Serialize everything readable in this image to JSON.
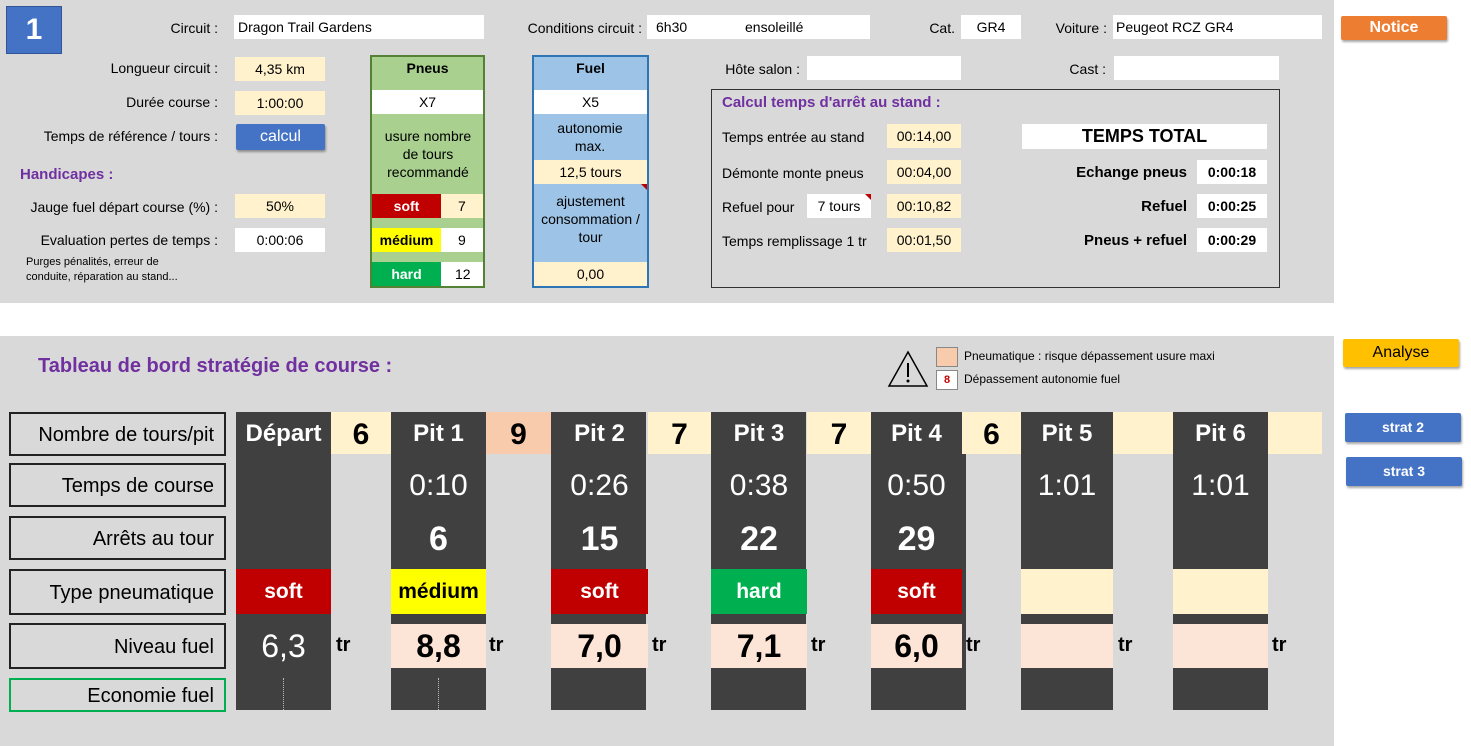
{
  "top": {
    "badge": "1",
    "circuit_label": "Circuit :",
    "circuit_value": "Dragon Trail Gardens",
    "conditions_label": "Conditions circuit :",
    "conditions_time": "6h30",
    "conditions_weather": "ensoleillé",
    "cat_label": "Cat.",
    "cat_value": "GR4",
    "car_label": "Voiture :",
    "car_value": "Peugeot RCZ GR4",
    "notice_button": "Notice",
    "length_label": "Longueur circuit :",
    "length_value": "4,35 km",
    "duration_label": "Durée course :",
    "duration_value": "1:00:00",
    "ref_time_label": "Temps de référence / tours :",
    "calc_button": "calcul",
    "handicap_title": "Handicapes :",
    "fuel_start_label": "Jauge fuel départ course (%) :",
    "fuel_start_value": "50%",
    "loss_label": "Evaluation pertes de temps :",
    "loss_value": "0:00:06",
    "loss_note_1": "Purges pénalités, erreur de",
    "loss_note_2": "conduite, réparation au stand...",
    "host_label": "Hôte salon :",
    "host_value": "",
    "cast_label": "Cast :",
    "cast_value": ""
  },
  "tyres": {
    "title": "Pneus",
    "multiplier": "X7",
    "wear_label": "usure nombre de tours recommandé",
    "soft_label": "soft",
    "soft_value": "7",
    "medium_label": "médium",
    "medium_value": "9",
    "hard_label": "hard",
    "hard_value": "12"
  },
  "fuel": {
    "title": "Fuel",
    "multiplier": "X5",
    "autonomy_label": "autonomie max.",
    "autonomy_value": "12,5 tours",
    "adjust_label": "ajustement consommation / tour",
    "adjust_value": "0,00"
  },
  "pit_calc": {
    "title": "Calcul temps d'arrêt au stand :",
    "entry_label": "Temps entrée au stand",
    "entry_value": "00:14,00",
    "tyre_change_label": "Démonte monte pneus",
    "tyre_change_value": "00:04,00",
    "refuel_label": "Refuel pour",
    "refuel_laps": "7 tours",
    "refuel_value": "00:10,82",
    "fill_label": "Temps remplissage 1 tr",
    "fill_value": "00:01,50",
    "total_title": "TEMPS TOTAL",
    "tot_tyres_label": "Echange pneus",
    "tot_tyres_value": "0:00:18",
    "tot_refuel_label": "Refuel",
    "tot_refuel_value": "0:00:25",
    "tot_both_label": "Pneus + refuel",
    "tot_both_value": "0:00:29"
  },
  "dashboard": {
    "title": "Tableau de bord stratégie de course :",
    "legend_tyre": "Pneumatique : risque dépassement usure maxi",
    "legend_fuel_badge": "8",
    "legend_fuel": "Dépassement autonomie fuel",
    "analyse_button": "Analyse",
    "strat2_button": "strat 2",
    "strat3_button": "strat 3",
    "row_laps": "Nombre de tours/pit",
    "row_time": "Temps de course",
    "row_stops": "Arrêts au tour",
    "row_tyre": "Type pneumatique",
    "row_fuel": "Niveau fuel",
    "row_eco": "Economie fuel",
    "tr_unit": "tr",
    "stints": [
      {
        "head": "Départ",
        "laps": "6",
        "time": "",
        "stop": "",
        "tyre": "soft",
        "fuel": "6,3"
      },
      {
        "head": "Pit 1",
        "laps": "9",
        "time": "0:10",
        "stop": "6",
        "tyre": "médium",
        "fuel": "8,8"
      },
      {
        "head": "Pit 2",
        "laps": "7",
        "time": "0:26",
        "stop": "15",
        "tyre": "soft",
        "fuel": "7,0"
      },
      {
        "head": "Pit 3",
        "laps": "7",
        "time": "0:38",
        "stop": "22",
        "tyre": "hard",
        "fuel": "7,1"
      },
      {
        "head": "Pit 4",
        "laps": "6",
        "time": "0:50",
        "stop": "29",
        "tyre": "soft",
        "fuel": "6,0"
      },
      {
        "head": "Pit 5",
        "laps": "",
        "time": "1:01",
        "stop": "",
        "tyre": "",
        "fuel": ""
      },
      {
        "head": "Pit 6",
        "laps": "",
        "time": "1:01",
        "stop": "",
        "tyre": "",
        "fuel": ""
      }
    ]
  },
  "colors": {
    "soft": "#c00000",
    "medium": "#ffff00",
    "hard": "#00b050",
    "warn": "#f8cbad",
    "cream": "#fff2cc",
    "fuelcell": "#fce4d6",
    "accent_purple": "#7030a0",
    "notice_orange": "#ed7d31",
    "analyse_yellow": "#ffc000",
    "blue_button": "#4472c4"
  }
}
